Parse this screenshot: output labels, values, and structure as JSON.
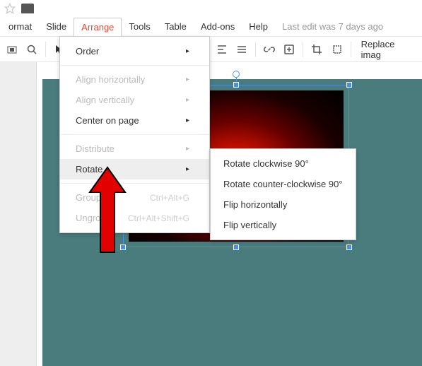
{
  "menubar": {
    "format": "ormat",
    "slide": "Slide",
    "arrange": "Arrange",
    "tools": "Tools",
    "table": "Table",
    "addons": "Add-ons",
    "help": "Help"
  },
  "edit_status": "Last edit was 7 days ago",
  "toolbar": {
    "replace_image": "Replace imag"
  },
  "dropdown": {
    "order": "Order",
    "align_h": "Align horizontally",
    "align_v": "Align vertically",
    "center": "Center on page",
    "distribute": "Distribute",
    "rotate": "Rotate",
    "group": "Group",
    "group_sc": "Ctrl+Alt+G",
    "ungroup": "Ungroup",
    "ungroup_sc": "Ctrl+Alt+Shift+G"
  },
  "submenu": {
    "cw": "Rotate clockwise 90°",
    "ccw": "Rotate counter-clockwise 90°",
    "flip_h": "Flip horizontally",
    "flip_v": "Flip vertically"
  }
}
